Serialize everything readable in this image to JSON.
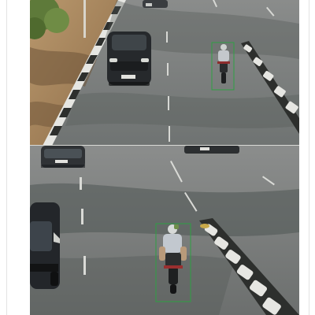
{
  "image": {
    "kind": "traffic-camera-composite",
    "panels": 2
  },
  "detections": {
    "top_panel": {
      "object": "motorcycle-with-rider",
      "box_color": "#2ea043"
    },
    "bottom_panel": {
      "object": "motorcycle-with-rider",
      "box_color": "#2ea043"
    }
  },
  "colors": {
    "road": "#7f8080",
    "road_shadow": "#4f5554",
    "curb_light": "#e6e6e2",
    "curb_dark": "#2d2f2d",
    "verge": "#a0825e",
    "tree": "#5e7a3a",
    "detection_box": "#2ea043"
  }
}
